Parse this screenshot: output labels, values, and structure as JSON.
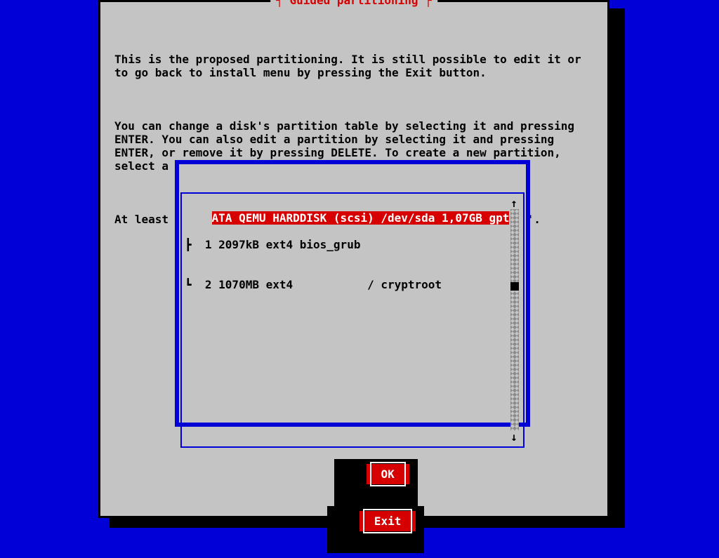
{
  "dialog": {
    "title": "┤ Guided partitioning ├",
    "para1": "This is the proposed partitioning. It is still possible to edit it or\nto go back to install menu by pressing the Exit button.",
    "para2": "You can change a disk's partition table by selecting it and pressing\nENTER. You can also edit a partition by selecting it and pressing\nENTER, or remove it by pressing DELETE. To create a new partition,\nselect a free space area and press ENTER.",
    "para3": "At least one partition must have its mounting point set to '/'."
  },
  "disk": {
    "header": "ATA QEMU HARDDISK (scsi) /dev/sda 1,07GB gpt",
    "partitions": [
      {
        "tree": "├ ",
        "num": "1",
        "size": "2097kB",
        "fs": "ext4",
        "flag": "bios_grub",
        "mount": "",
        "label": ""
      },
      {
        "tree": "└ ",
        "num": "2",
        "size": "1070MB",
        "fs": "ext4",
        "flag": "",
        "mount": "/",
        "label": "cryptroot"
      }
    ],
    "row1": "┣  1 2097kB ext4 bios_grub",
    "row2": "┗  2 1070MB ext4           / cryptroot"
  },
  "scroll": {
    "up": "↑",
    "down": "↓"
  },
  "buttons": {
    "ok": "OK",
    "exit": "Exit"
  }
}
